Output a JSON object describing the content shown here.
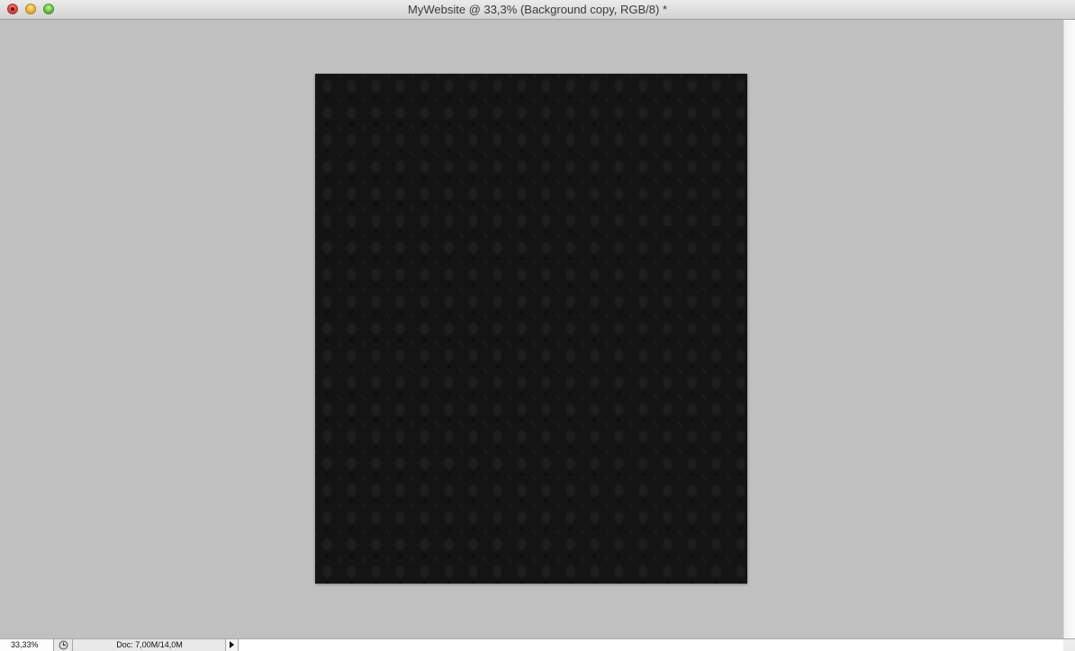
{
  "window": {
    "title": "MyWebsite @ 33,3% (Background copy, RGB/8) *"
  },
  "controls": {
    "close": "close-icon",
    "minimize": "minimize-icon",
    "zoom": "zoom-icon"
  },
  "document": {
    "background_color": "#141414",
    "pattern": "dark damask"
  },
  "status": {
    "zoom": "33,33%",
    "doc_info": "Doc: 7,00M/14,0M",
    "info_icon": "timer-icon",
    "menu_icon": "triangle-right-icon"
  },
  "colors": {
    "workspace": "#c0c0c0",
    "close": "#e0443e",
    "minimize": "#f2b132",
    "zoom": "#6cc33e"
  }
}
